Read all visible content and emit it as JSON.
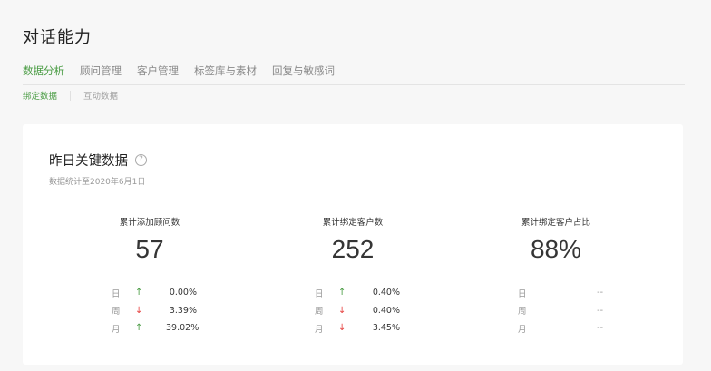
{
  "page_title": "对话能力",
  "tabs": [
    {
      "label": "数据分析",
      "active": true
    },
    {
      "label": "顾问管理",
      "active": false
    },
    {
      "label": "客户管理",
      "active": false
    },
    {
      "label": "标签库与素材",
      "active": false
    },
    {
      "label": "回复与敏感词",
      "active": false
    }
  ],
  "subtabs": [
    {
      "label": "绑定数据",
      "active": true
    },
    {
      "label": "互动数据",
      "active": false
    }
  ],
  "card": {
    "title": "昨日关键数据",
    "help_icon": "question-circle-icon",
    "subtitle": "数据统计至2020年6月1日"
  },
  "metrics": [
    {
      "label": "累计添加顾问数",
      "value": "57",
      "rows": [
        {
          "period": "日",
          "direction": "up",
          "arrow": "↑",
          "change": "0.00%"
        },
        {
          "period": "周",
          "direction": "down",
          "arrow": "↓",
          "change": "3.39%"
        },
        {
          "period": "月",
          "direction": "up",
          "arrow": "↑",
          "change": "39.02%"
        }
      ]
    },
    {
      "label": "累计绑定客户数",
      "value": "252",
      "rows": [
        {
          "period": "日",
          "direction": "up",
          "arrow": "↑",
          "change": "0.40%"
        },
        {
          "period": "周",
          "direction": "down",
          "arrow": "↓",
          "change": "0.40%"
        },
        {
          "period": "月",
          "direction": "down",
          "arrow": "↓",
          "change": "3.45%"
        }
      ]
    },
    {
      "label": "累计绑定客户占比",
      "value": "88%",
      "rows": [
        {
          "period": "日",
          "change": "--"
        },
        {
          "period": "周",
          "change": "--"
        },
        {
          "period": "月",
          "change": "--"
        }
      ]
    }
  ],
  "colors": {
    "accent": "#4a9c44",
    "up": "#4a9c44",
    "down": "#e64340"
  }
}
